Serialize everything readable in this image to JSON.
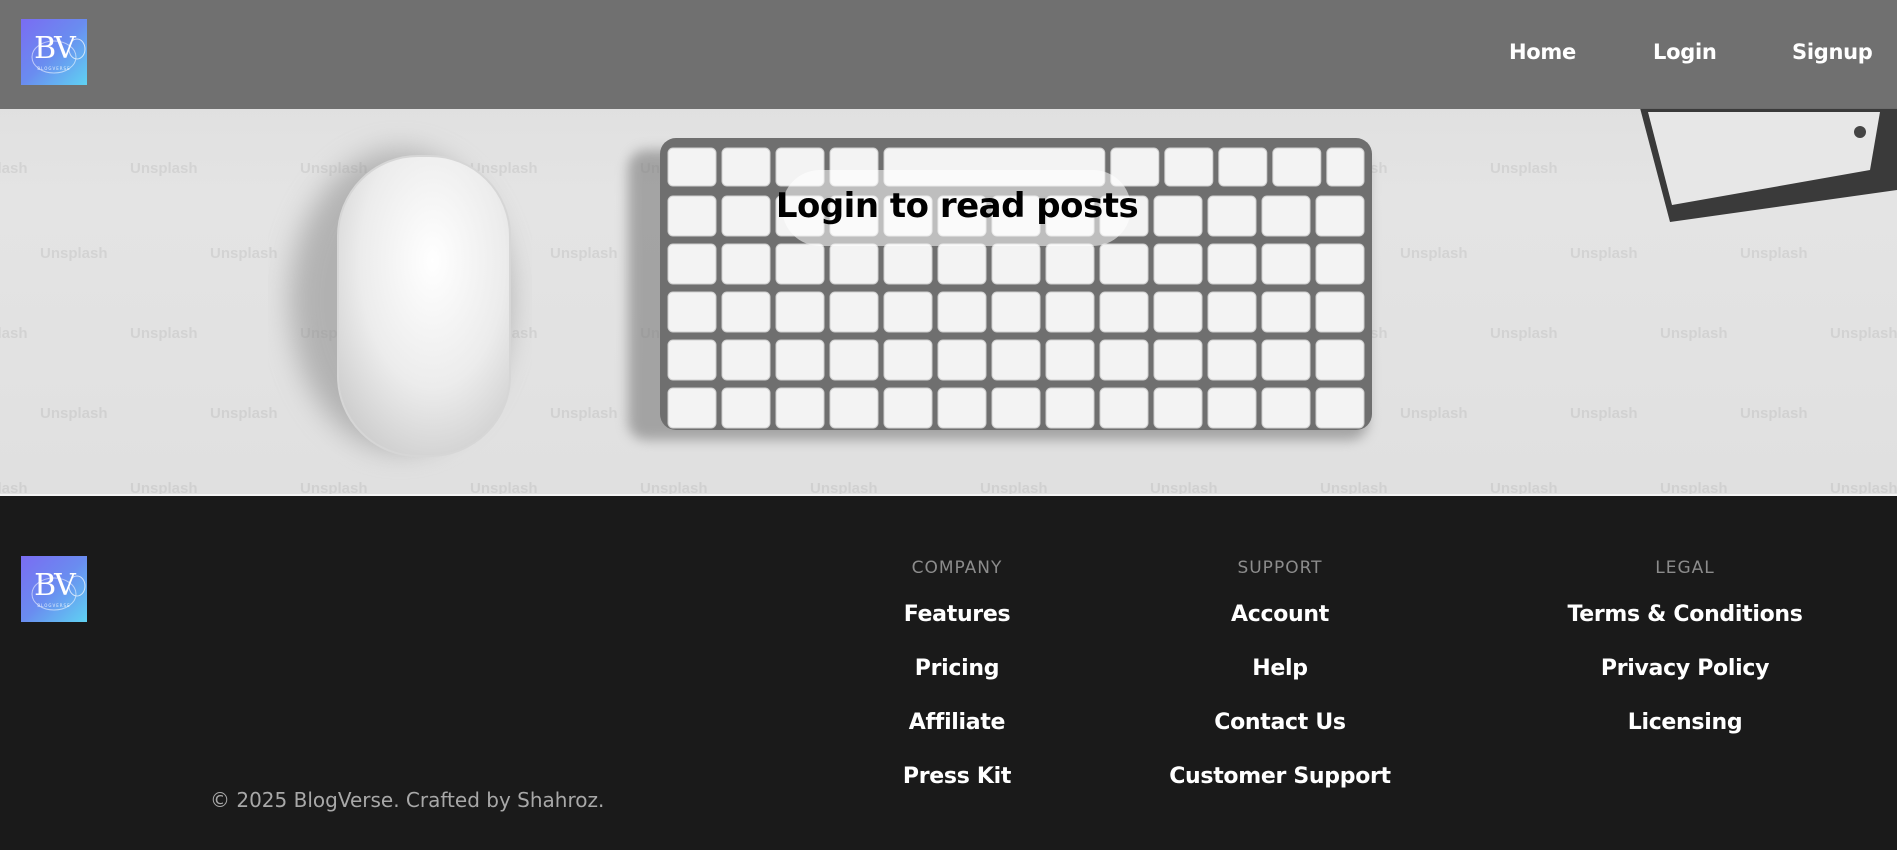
{
  "brand": {
    "logo_text": "BV",
    "logo_subtext": "BLOGVERSE",
    "colors": {
      "logo_gradient_start": "#7a6cf2",
      "logo_gradient_end": "#5fd2f2"
    }
  },
  "nav": {
    "items": [
      {
        "label": "Home"
      },
      {
        "label": "Login"
      },
      {
        "label": "Signup"
      }
    ]
  },
  "hero": {
    "title": "Login to read posts",
    "image_subject": "keyboard-and-mouse-on-desk",
    "watermark_text": "Unsplash"
  },
  "footer": {
    "copyright": "© 2025 BlogVerse. Crafted by Shahroz.",
    "columns": [
      {
        "heading": "COMPANY",
        "links": [
          "Features",
          "Pricing",
          "Affiliate",
          "Press Kit"
        ]
      },
      {
        "heading": "SUPPORT",
        "links": [
          "Account",
          "Help",
          "Contact Us",
          "Customer Support"
        ]
      },
      {
        "heading": "LEGAL",
        "links": [
          "Terms & Conditions",
          "Privacy Policy",
          "Licensing"
        ]
      }
    ],
    "colors": {
      "background": "#1a1a1a",
      "heading": "#8c8c8c",
      "link": "#ffffff"
    }
  }
}
